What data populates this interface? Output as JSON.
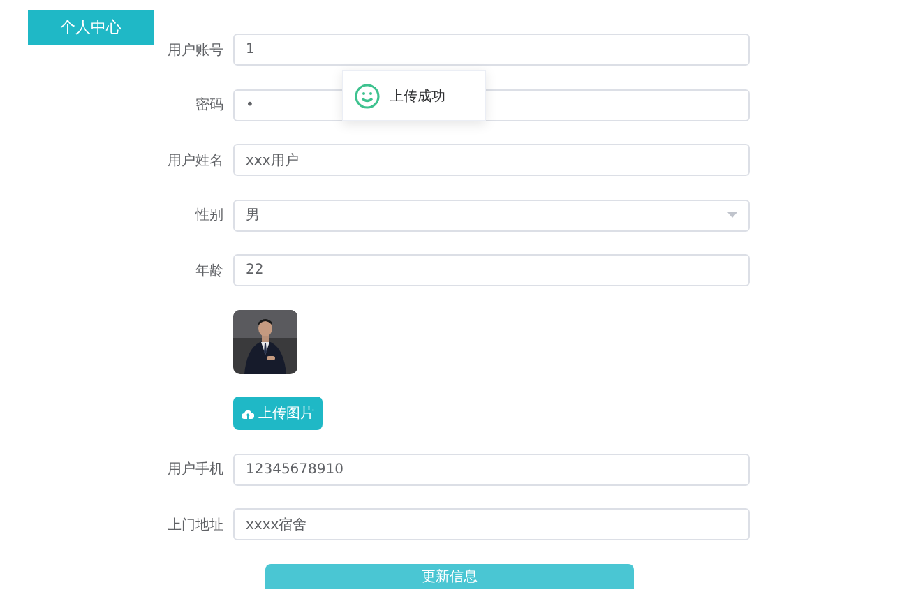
{
  "header": {
    "title": "个人中心"
  },
  "fields": [
    {
      "kind": "text",
      "label": "用户账号",
      "value": "1"
    },
    {
      "kind": "text",
      "label": "密码",
      "value": "•"
    },
    {
      "kind": "text",
      "label": "用户姓名",
      "value": "xxx用户"
    },
    {
      "kind": "select",
      "label": "性别",
      "value": "男"
    },
    {
      "kind": "text",
      "label": "年龄",
      "value": "22"
    }
  ],
  "upload_button": {
    "label": "上传图片"
  },
  "contact_fields": [
    {
      "kind": "text",
      "label": "用户手机",
      "value": "12345678910"
    },
    {
      "kind": "text",
      "label": "上门地址",
      "value": "xxxx宿舍"
    }
  ],
  "submit_button": {
    "label": "更新信息"
  },
  "toast": {
    "message": "上传成功"
  }
}
